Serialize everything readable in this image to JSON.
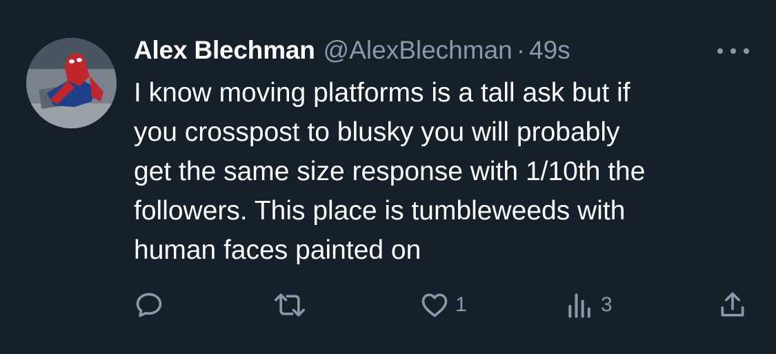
{
  "tweet": {
    "display_name": "Alex Blechman",
    "handle": "@AlexBlechman",
    "separator": "·",
    "time": "49s",
    "text": "I know moving platforms is a tall ask but if\nyou crosspost to blusky you will probably\nget the same size response with 1/10th the\nfollowers. This place is tumbleweeds with\nhuman faces painted on"
  },
  "actions": {
    "reply_icon": "reply-icon",
    "retweet_icon": "retweet-icon",
    "like_icon": "heart-icon",
    "like_count": "1",
    "views_icon": "views-icon",
    "views_count": "3",
    "share_icon": "share-icon"
  },
  "colors": {
    "background": "#15202b",
    "secondary_text": "#8b98a5",
    "primary_text": "#ffffff"
  }
}
